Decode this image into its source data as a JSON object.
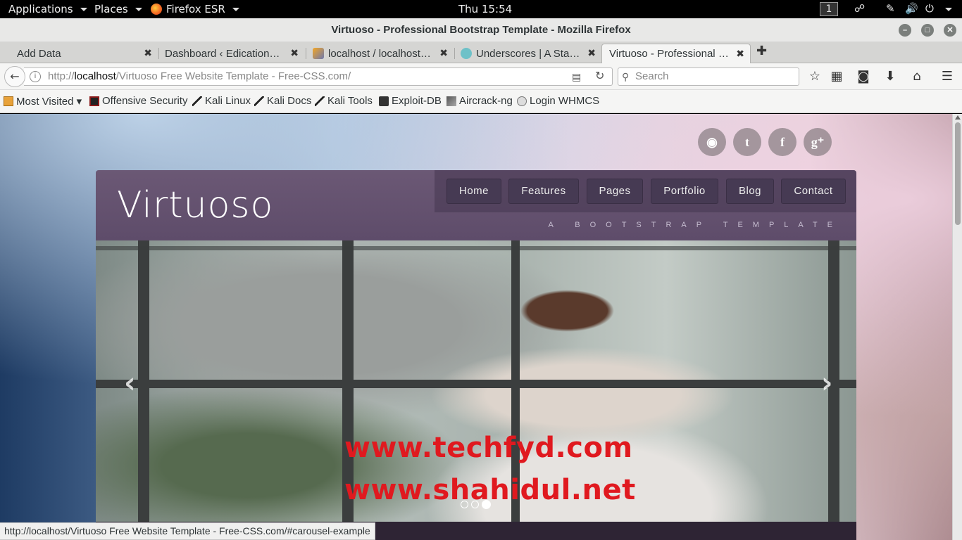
{
  "gnome_bar": {
    "applications": "Applications",
    "places": "Places",
    "app_name": "Firefox ESR",
    "clock": "Thu 15:54",
    "workspace": "1"
  },
  "window": {
    "title": "Virtuoso - Professional Bootstrap Template - Mozilla Firefox"
  },
  "tabs": [
    {
      "label": "Add Data",
      "active": false
    },
    {
      "label": "Dashboard ‹ EdicationSite…",
      "active": false
    },
    {
      "label": "localhost / localhost /…",
      "active": false
    },
    {
      "label": "Underscores | A Start…",
      "active": false
    },
    {
      "label": "Virtuoso - Professional B…",
      "active": true
    }
  ],
  "url": {
    "prefix": "http://",
    "host": "localhost",
    "path": "/Virtuoso Free Website Template - Free-CSS.com/"
  },
  "search": {
    "placeholder": "Search"
  },
  "bookmarks": [
    {
      "label": "Most Visited ▾",
      "icon": "most-visited-icon"
    },
    {
      "label": "Offensive Security",
      "icon": "offsec-icon"
    },
    {
      "label": "Kali Linux",
      "icon": "kali-icon"
    },
    {
      "label": "Kali Docs",
      "icon": "kali-icon"
    },
    {
      "label": "Kali Tools",
      "icon": "kali-icon"
    },
    {
      "label": "Exploit-DB",
      "icon": "exploitdb-icon"
    },
    {
      "label": "Aircrack-ng",
      "icon": "aircrack-icon"
    },
    {
      "label": "Login WHMCS",
      "icon": "globe-icon"
    }
  ],
  "site": {
    "logo": "Virtuoso",
    "tagline": "A BOOTSTRAP TEMPLATE",
    "nav": [
      "Home",
      "Features",
      "Pages",
      "Portfolio",
      "Blog",
      "Contact"
    ],
    "social_icons": [
      "rss-icon",
      "twitter-icon",
      "facebook-icon",
      "google-plus-icon"
    ],
    "carousel": {
      "watermark_1": "www.techfyd.com",
      "watermark_2": "www.shahidul.net",
      "slides": 3,
      "active_slide": 3
    }
  },
  "status": "http://localhost/Virtuoso Free Website Template - Free-CSS.com/#carousel-example",
  "colors": {
    "header_purple": "#6b5875",
    "nav_button": "#463a53",
    "watermark_red": "#e0191f"
  }
}
